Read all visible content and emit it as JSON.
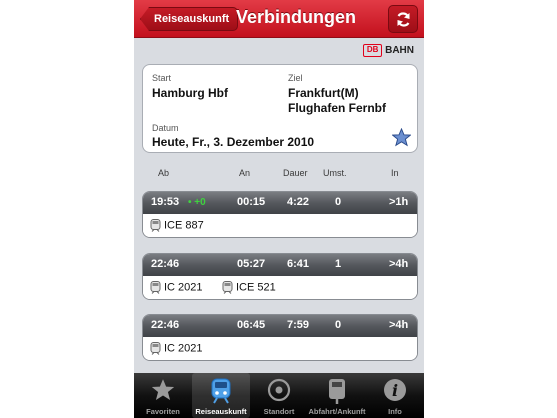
{
  "nav": {
    "back_label": "Reiseauskunft",
    "title": "Verbindungen"
  },
  "brand": {
    "box": "DB",
    "word": "BAHN"
  },
  "request": {
    "start_label": "Start",
    "start_value": "Hamburg Hbf",
    "ziel_label": "Ziel",
    "ziel_line1": "Frankfurt(M)",
    "ziel_line2": "Flughafen Fernbf",
    "datum_label": "Datum",
    "datum_value": "Heute, Fr., 3. Dezember 2010"
  },
  "columns": {
    "ab": "Ab",
    "an": "An",
    "dauer": "Dauer",
    "umst": "Umst.",
    "in": "In"
  },
  "connections": [
    {
      "ab": "19:53",
      "delay": "• +0",
      "an": "00:15",
      "dauer": "4:22",
      "umst": "0",
      "in": ">1h",
      "trains": [
        "ICE 887"
      ]
    },
    {
      "ab": "22:46",
      "delay": "",
      "an": "05:27",
      "dauer": "6:41",
      "umst": "1",
      "in": ">4h",
      "trains": [
        "IC 2021",
        "ICE 521"
      ]
    },
    {
      "ab": "22:46",
      "delay": "",
      "an": "06:45",
      "dauer": "7:59",
      "umst": "0",
      "in": ">4h",
      "trains": [
        "IC 2021"
      ]
    }
  ],
  "tabs": [
    {
      "label": "Favoriten",
      "icon": "star-icon"
    },
    {
      "label": "Reiseauskunft",
      "icon": "train-icon"
    },
    {
      "label": "Standort",
      "icon": "location-icon"
    },
    {
      "label": "Abfahrt/Ankunft",
      "icon": "departure-board-icon"
    },
    {
      "label": "Info",
      "icon": "info-icon"
    }
  ],
  "colors": {
    "nav_red": "#c3101d",
    "db_red": "#e2001a",
    "delay_green": "#3fd33f",
    "star_blue": "#3a5fa8"
  }
}
